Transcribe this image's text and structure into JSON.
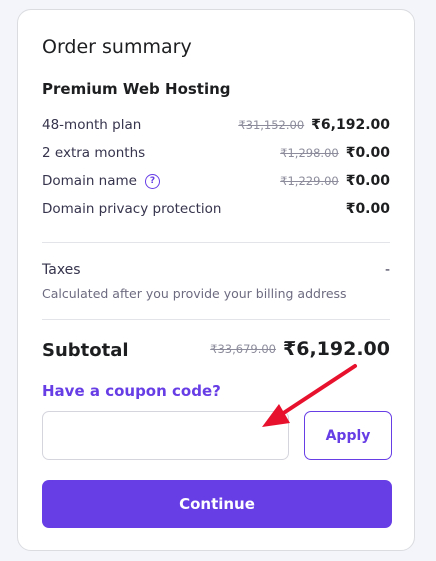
{
  "title": "Order summary",
  "product_name": "Premium Web Hosting",
  "items": [
    {
      "label": "48-month plan",
      "old_price": "₹31,152.00",
      "price": "₹6,192.00"
    },
    {
      "label": "2 extra months",
      "old_price": "₹1,298.00",
      "price": "₹0.00"
    },
    {
      "label": "Domain name",
      "old_price": "₹1,229.00",
      "price": "₹0.00"
    },
    {
      "label": "Domain privacy protection",
      "old_price": "",
      "price": "₹0.00"
    }
  ],
  "help_icon_glyph": "?",
  "taxes": {
    "label": "Taxes",
    "value": "-",
    "note": "Calculated after you provide your billing address"
  },
  "subtotal": {
    "label": "Subtotal",
    "old_price": "₹33,679.00",
    "price": "₹6,192.00"
  },
  "coupon": {
    "link_text": "Have a coupon code?",
    "input_value": "",
    "placeholder": "",
    "apply_label": "Apply"
  },
  "continue_label": "Continue",
  "colors": {
    "accent": "#673de6",
    "annotation_arrow": "#e8112d"
  }
}
